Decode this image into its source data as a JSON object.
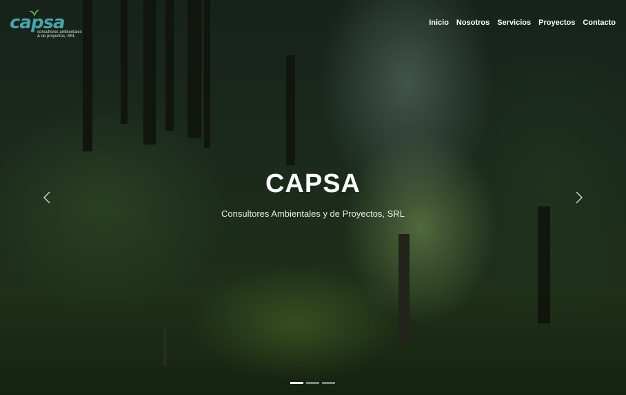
{
  "brand": {
    "logo_text": "capsa",
    "logo_tagline": "consultores ambientales & de proyectos, SRL",
    "logo_color": "#4aa3a8",
    "leaf_color": "#7cc241"
  },
  "nav": {
    "items": [
      {
        "label": "Inicio"
      },
      {
        "label": "Nosotros"
      },
      {
        "label": "Servicios"
      },
      {
        "label": "Proyectos"
      },
      {
        "label": "Contacto"
      }
    ]
  },
  "hero": {
    "title": "CAPSA",
    "subtitle": "Consultores Ambientales y de Proyectos, SRL",
    "background": "forest-photo",
    "prev_icon": "chevron-left-icon",
    "next_icon": "chevron-right-icon"
  },
  "carousel": {
    "slide_count": 3,
    "active_index": 0
  }
}
